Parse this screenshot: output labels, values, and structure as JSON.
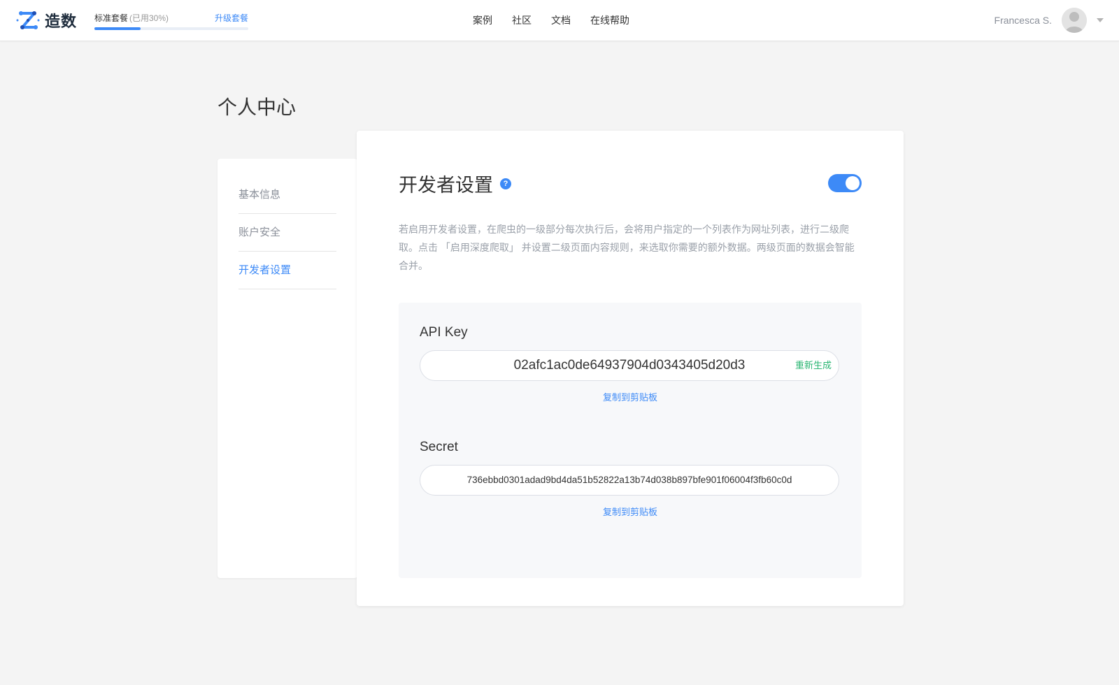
{
  "header": {
    "brand": "造数",
    "logo_icon": "zaoshu-logo-icon",
    "plan": {
      "name": "标准套餐",
      "usage": "(已用30%)",
      "usage_percent": 30,
      "upgrade_label": "升级套餐"
    },
    "nav": [
      {
        "label": "案例"
      },
      {
        "label": "社区"
      },
      {
        "label": "文档"
      },
      {
        "label": "在线帮助"
      }
    ],
    "user": {
      "name": "Francesca S.",
      "avatar_icon": "avatar-icon",
      "menu_icon": "caret-down-icon"
    }
  },
  "page": {
    "title": "个人中心"
  },
  "sidebar": {
    "items": [
      {
        "label": "基本信息",
        "active": false
      },
      {
        "label": "账户安全",
        "active": false
      },
      {
        "label": "开发者设置",
        "active": true
      }
    ]
  },
  "developer": {
    "title": "开发者设置",
    "help_icon": "question-icon",
    "help_glyph": "?",
    "enabled": true,
    "description": "若启用开发者设置，在爬虫的一级部分每次执行后，会将用户指定的一个列表作为网址列表，进行二级爬取。点击 「启用深度爬取」 并设置二级页面内容规则，来选取你需要的额外数据。两级页面的数据会智能合并。",
    "api_key": {
      "label": "API Key",
      "value": "02afc1ac0de64937904d0343405d20d3",
      "regenerate_label": "重新生成",
      "copy_label": "复制到剪贴板"
    },
    "secret": {
      "label": "Secret",
      "value": "736ebbd0301adad9bd4da51b52822a13b74d038b897bfe901f06004f3fb60c0d",
      "copy_label": "复制到剪贴板"
    }
  },
  "colors": {
    "accent": "#3d8af7",
    "success": "#2bb673",
    "background": "#f4f4f4"
  }
}
